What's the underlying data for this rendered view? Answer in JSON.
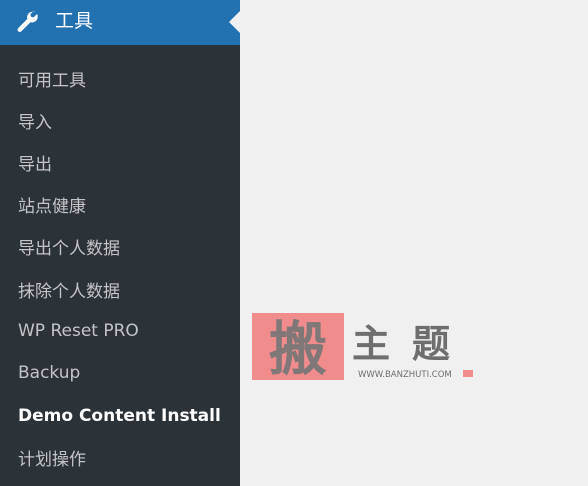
{
  "menu": {
    "title": "工具",
    "icon": "wrench-icon",
    "accent": "#2271b1",
    "sidebar_bg": "#2c3338",
    "items": [
      {
        "label": "可用工具",
        "current": false
      },
      {
        "label": "导入",
        "current": false
      },
      {
        "label": "导出",
        "current": false
      },
      {
        "label": "站点健康",
        "current": false
      },
      {
        "label": "导出个人数据",
        "current": false
      },
      {
        "label": "抹除个人数据",
        "current": false
      },
      {
        "label": "WP Reset PRO",
        "current": false
      },
      {
        "label": "Backup",
        "current": false
      },
      {
        "label": "Demo Content Install",
        "current": true
      },
      {
        "label": "计划操作",
        "current": false
      }
    ]
  },
  "watermark": {
    "main_char": "搬",
    "brand": "主题",
    "url": "WWW.BANZHUTI.COM"
  }
}
